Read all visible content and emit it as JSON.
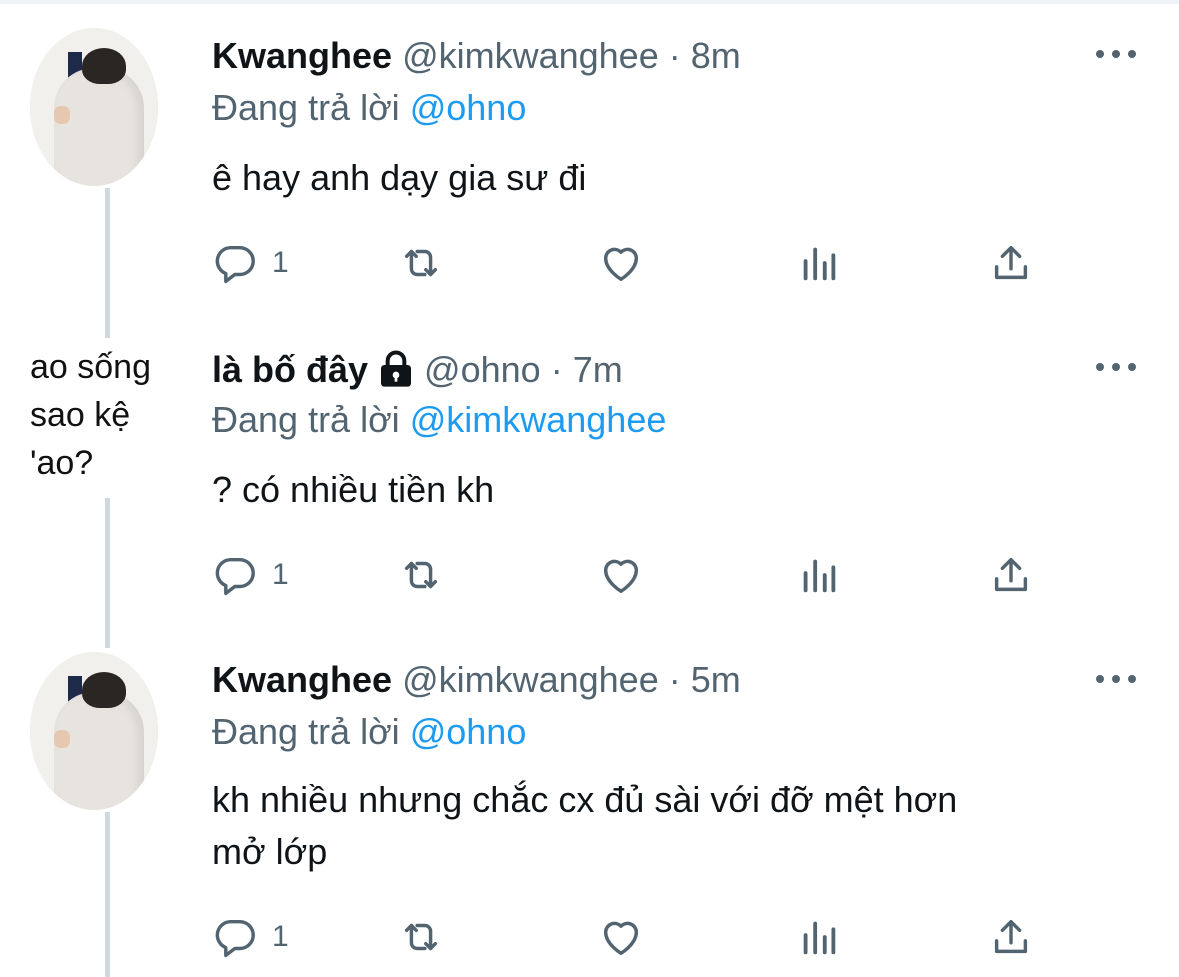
{
  "colors": {
    "accent": "#1d9bf0",
    "muted": "#536471",
    "text": "#0f1419",
    "thread_line": "#cfd9de"
  },
  "tweets": [
    {
      "name": "Kwanghee",
      "handle": "@kimkwanghee",
      "time": "· 8m",
      "replying_prefix": "Đang trả lời",
      "replying_to": "@ohno",
      "text": "ê hay anh dạy gia sư đi",
      "reply_count": "1",
      "avatar": "profile-photo"
    },
    {
      "name": "là bố đây",
      "handle": "@ohno",
      "time": "· 7m",
      "protected": true,
      "replying_prefix": "Đang trả lời",
      "replying_to": "@kimkwanghee",
      "text": "? có nhiều tiền kh",
      "reply_count": "1",
      "avatar": "meme-text",
      "avatar_lines": [
        "ao sống",
        "sao    kệ",
        "'ao?"
      ]
    },
    {
      "name": "Kwanghee",
      "handle": "@kimkwanghee",
      "time": "· 5m",
      "replying_prefix": "Đang trả lời",
      "replying_to": "@ohno",
      "text_lines": [
        "kh nhiều nhưng chắc cx đủ sài với đỡ mệt hơn",
        "mở lớp"
      ],
      "reply_count": "1",
      "avatar": "profile-photo"
    }
  ],
  "icons": [
    "reply-icon",
    "retweet-icon",
    "like-icon",
    "analytics-icon",
    "share-icon",
    "more-icon",
    "lock-icon"
  ]
}
